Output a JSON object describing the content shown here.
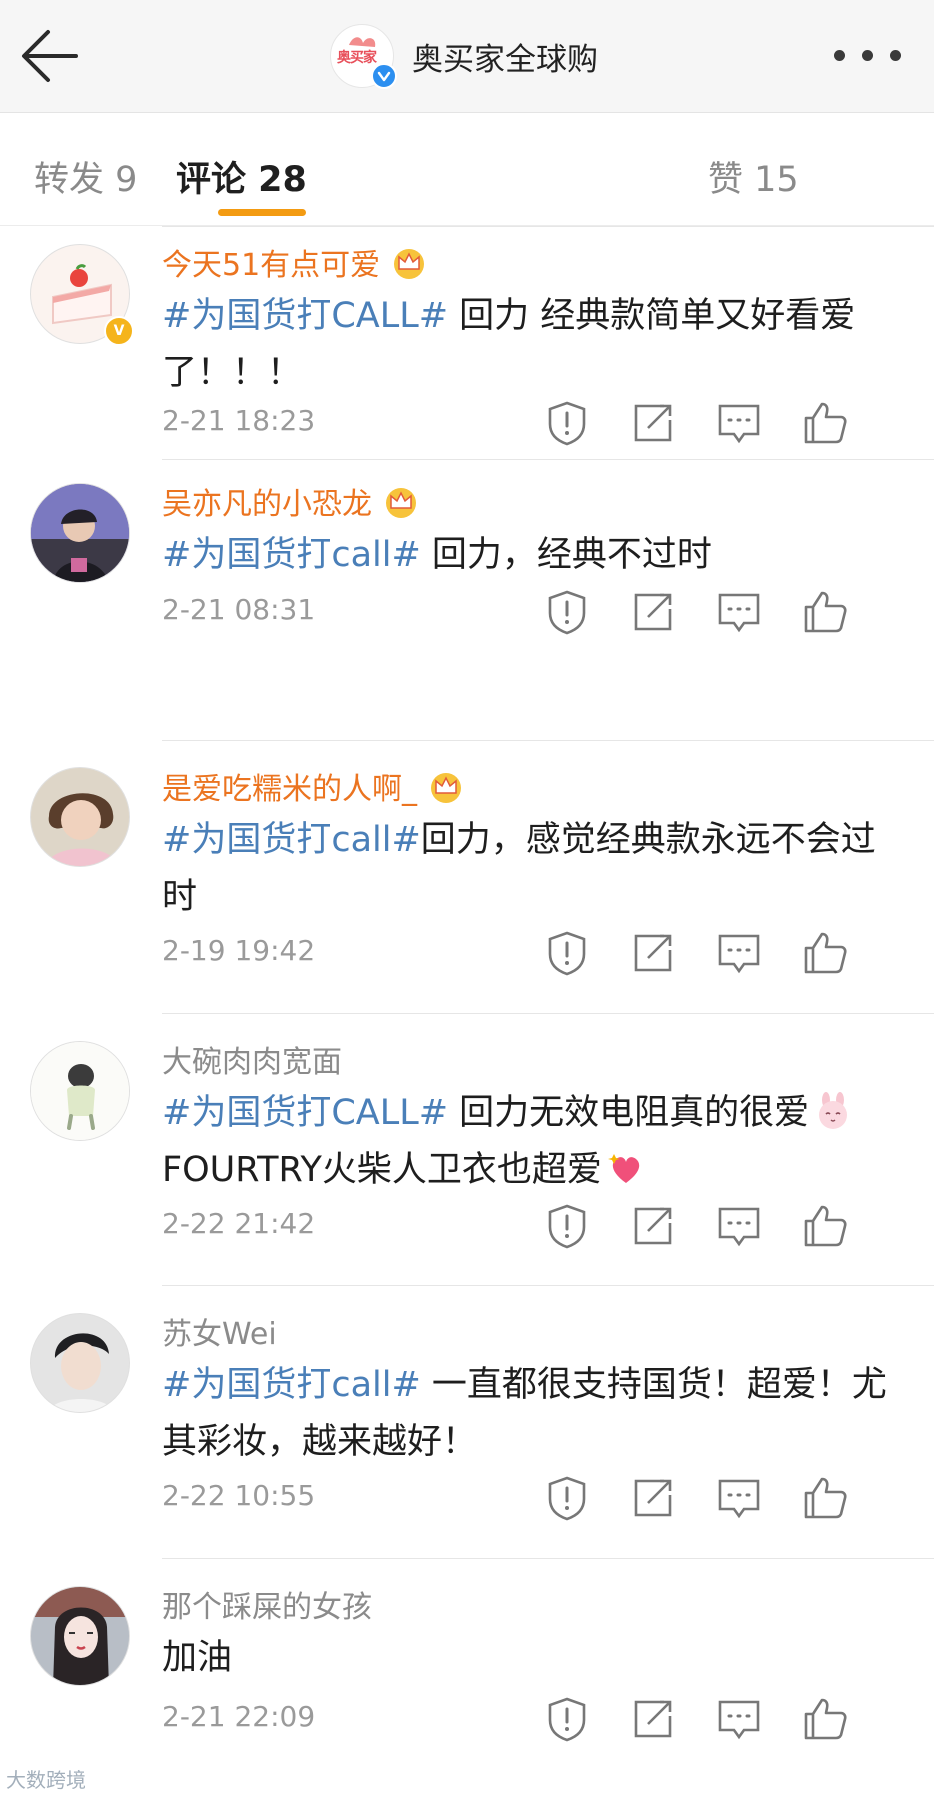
{
  "header": {
    "title": "奥买家全球购",
    "logo_text": "奥买家"
  },
  "tabs": [
    {
      "label": "转发 9"
    },
    {
      "label": "评论 28"
    },
    {
      "label": "赞 15"
    }
  ],
  "comments": [
    {
      "username": "今天51有点可爱",
      "topic": "#为国货打CALL#",
      "text": " 回力 经典款简单又好看爱了！！！",
      "time": "2-21 18:23"
    },
    {
      "username": "吴亦凡的小恐龙",
      "topic": "#为国货打call#",
      "text": " 回力，经典不过时",
      "time": "2-21 08:31"
    },
    {
      "username": "是爱吃糯米的人啊_",
      "topic": "#为国货打call#",
      "text": "回力，感觉经典款永远不会过时",
      "time": "2-19 19:42"
    },
    {
      "username": "大碗肉肉宽面",
      "topic": "#为国货打CALL#",
      "text": " 回力无效电阻真的很爱",
      "text2": "FOURTRY火柴人卫衣也超爱",
      "time": "2-22 21:42"
    },
    {
      "username": "苏女Wei",
      "topic": "#为国货打call#",
      "text": " 一直都很支持国货！超爱！尤其彩妆，越来越好！",
      "time": "2-22 10:55"
    },
    {
      "username": "那个踩屎的女孩",
      "topic": "",
      "text": "加油",
      "time": "2-21 22:09"
    }
  ],
  "watermark": "大数跨境",
  "colors": {
    "accent_orange": "#f39b12",
    "vip_name": "#eb7420",
    "topic_link": "#4a7fb8",
    "verified_blue": "#2c8ff0"
  }
}
